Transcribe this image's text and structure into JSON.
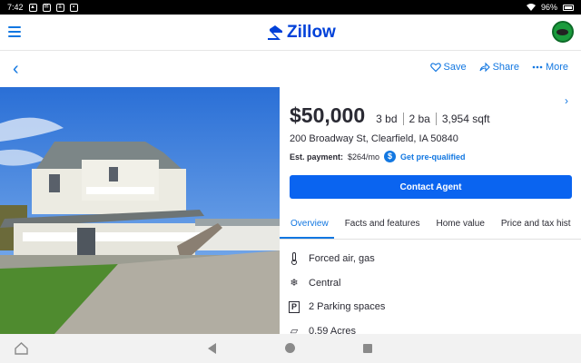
{
  "status_bar": {
    "time": "7:42",
    "battery": "96%"
  },
  "app_bar": {
    "logo_text": "Zillow"
  },
  "toolbar": {
    "save": "Save",
    "share": "Share",
    "more": "More"
  },
  "listing": {
    "price": "$50,000",
    "beds": "3 bd",
    "baths": "2 ba",
    "sqft": "3,954 sqft",
    "address": "200 Broadway St, Clearfield, IA 50840",
    "est_label": "Est. payment:",
    "est_value": "$264/mo",
    "prequal": "Get pre-qualified",
    "contact": "Contact Agent"
  },
  "tabs": [
    "Overview",
    "Facts and features",
    "Home value",
    "Price and tax hist"
  ],
  "features": [
    {
      "icon": "thermometer-icon",
      "label": "Forced air, gas"
    },
    {
      "icon": "snowflake-icon",
      "label": "Central"
    },
    {
      "icon": "parking-icon",
      "label": "2 Parking spaces"
    },
    {
      "icon": "lot-icon",
      "label": "0.59 Acres"
    }
  ],
  "colors": {
    "accent": "#1277e1",
    "brand": "#0041d9",
    "button": "#0a64f0"
  }
}
